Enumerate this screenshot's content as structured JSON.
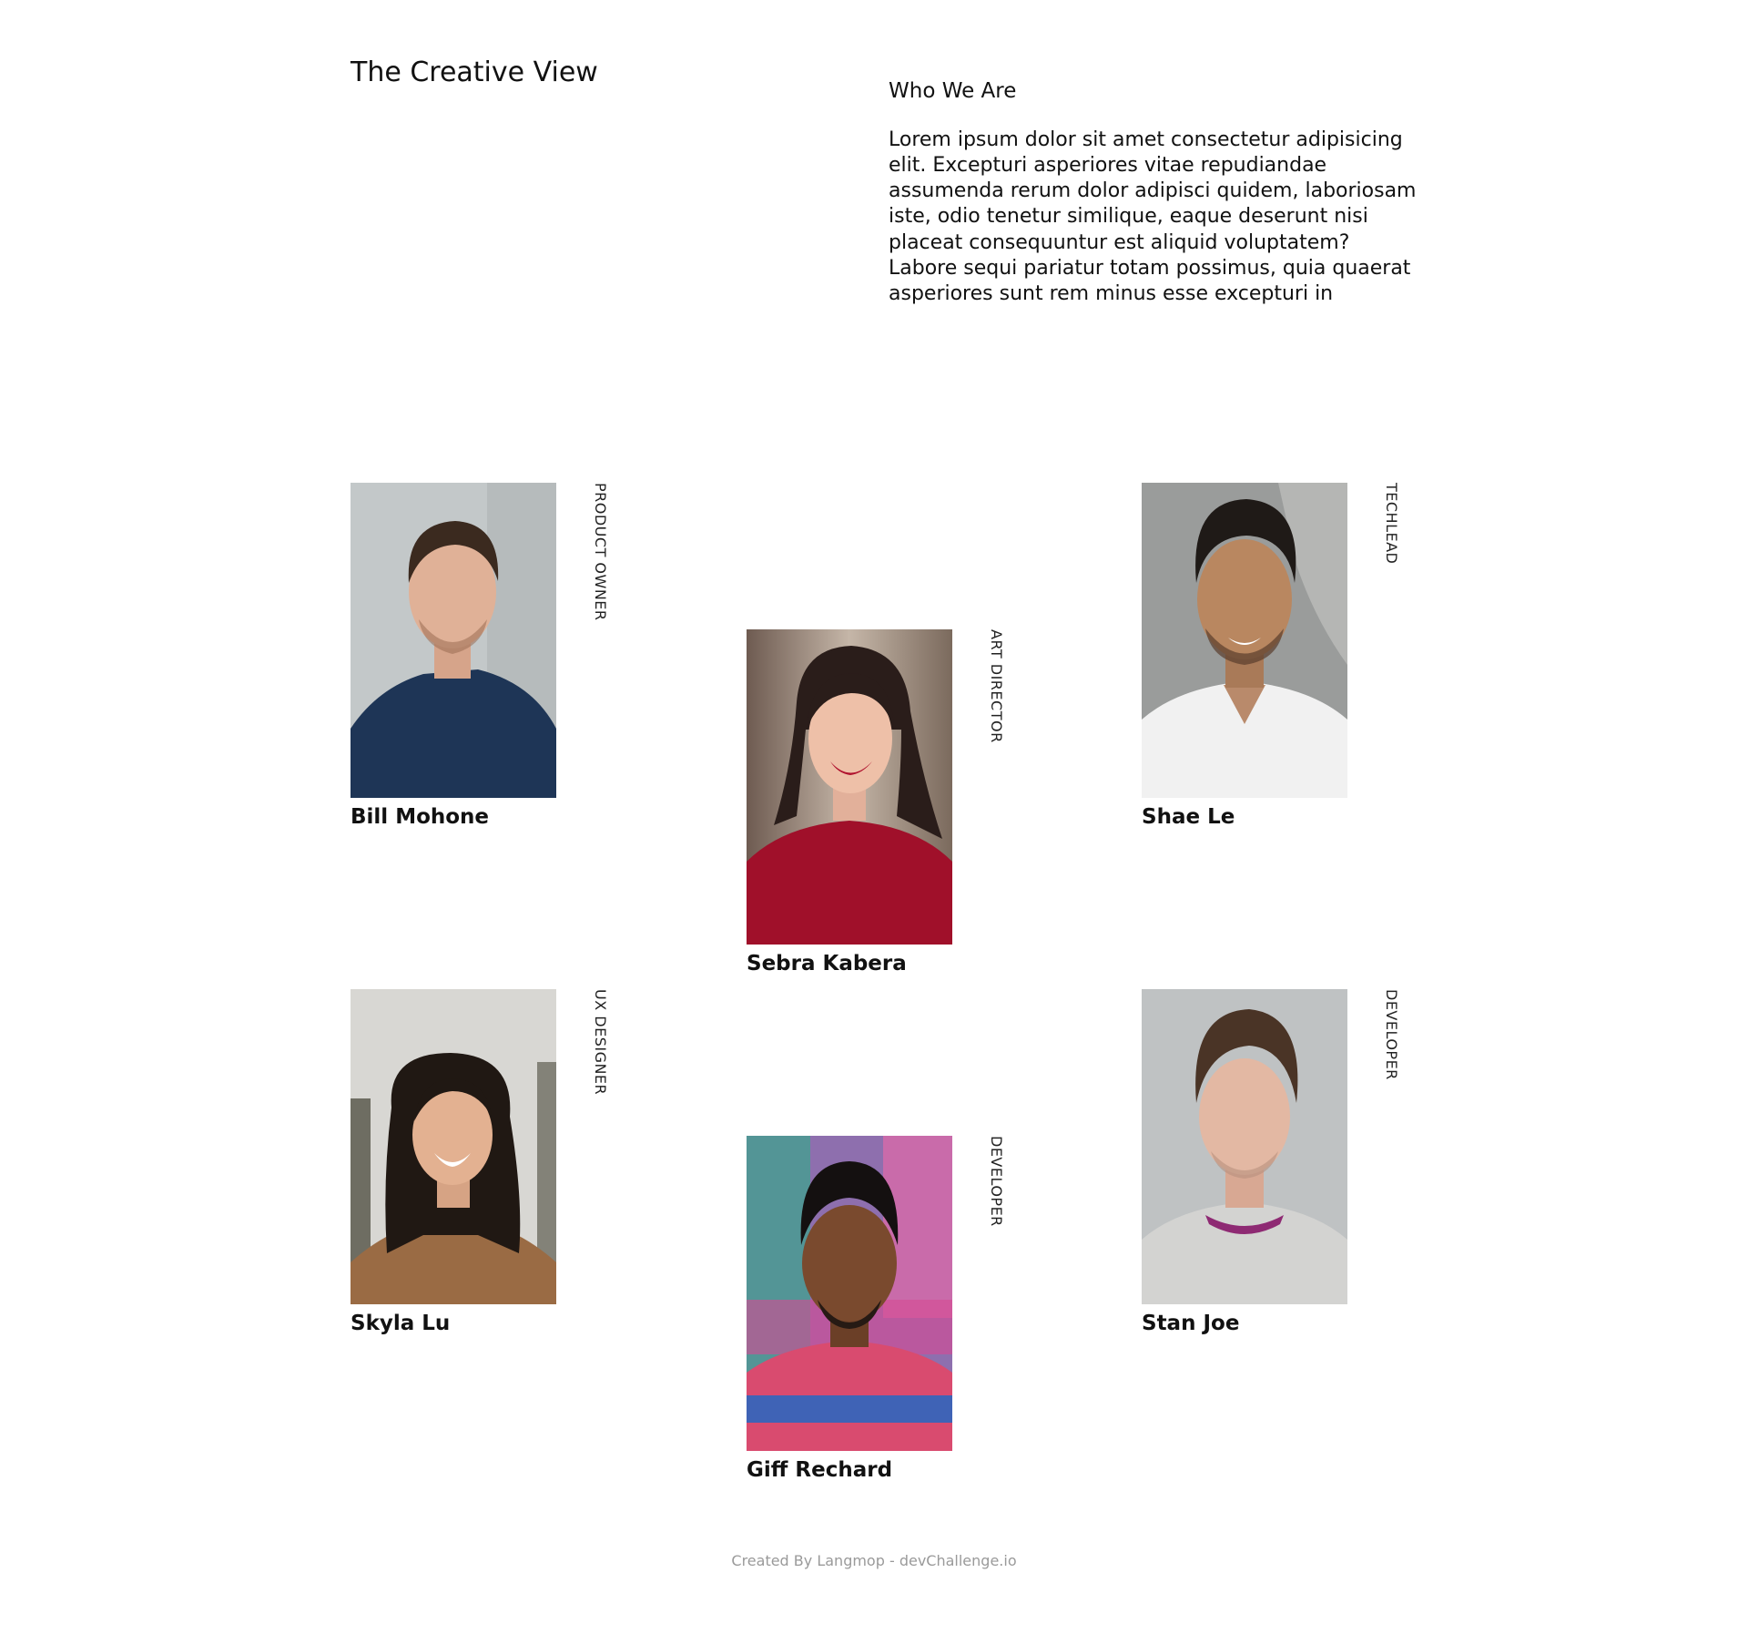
{
  "site": {
    "title": "The Creative View"
  },
  "about": {
    "heading": "Who We Are",
    "text": "Lorem ipsum dolor sit amet consectetur adipisicing elit. Excepturi asperiores vitae repudiandae assumenda rerum dolor adipisci quidem, laboriosam iste, odio tenetur similique, eaque deserunt nisi placeat consequuntur est aliquid voluptatem? Labore sequi pariatur totam possimus, quia quaerat asperiores sunt rem minus esse excepturi in"
  },
  "team": [
    {
      "name": "Bill Mohone",
      "role": "PRODUCT OWNER"
    },
    {
      "name": "Sebra Kabera",
      "role": "ART DIRECTOR"
    },
    {
      "name": "Shae Le",
      "role": "TECHLEAD"
    },
    {
      "name": "Skyla Lu",
      "role": "UX DESIGNER"
    },
    {
      "name": "Giff Rechard",
      "role": "DEVELOPER"
    },
    {
      "name": "Stan Joe",
      "role": "DEVELOPER"
    }
  ],
  "footer": {
    "credit": "Created By Langmop - devChallenge.io"
  }
}
